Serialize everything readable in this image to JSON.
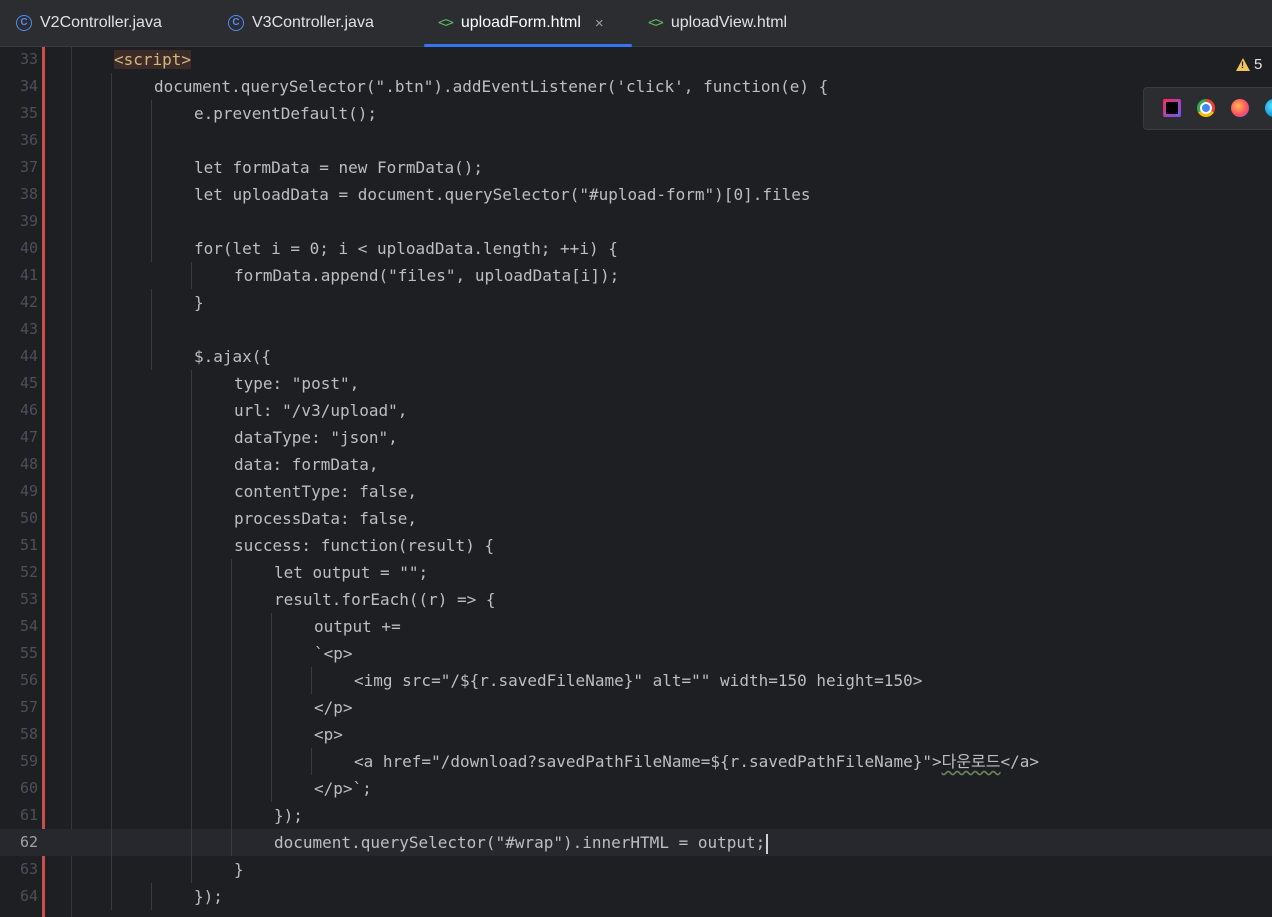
{
  "tabs": [
    {
      "label": "V2Controller.java",
      "icon": "class-icon",
      "active": false
    },
    {
      "label": "V3Controller.java",
      "icon": "class-icon",
      "active": false
    },
    {
      "label": "uploadForm.html",
      "icon": "html-icon",
      "active": true
    },
    {
      "label": "uploadView.html",
      "icon": "html-icon",
      "active": false
    }
  ],
  "tab_close_glyph": "×",
  "inspections": {
    "warning_count": "5"
  },
  "browser_icons": [
    "intellij-icon",
    "chrome-icon",
    "firefox-icon",
    "edge-icon"
  ],
  "editor": {
    "current_line": 62,
    "lines": [
      {
        "n": "33",
        "text": "<script>"
      },
      {
        "n": "34",
        "text": "document.querySelector(\".btn\").addEventListener('click', function(e) {"
      },
      {
        "n": "35",
        "text": "e.preventDefault();"
      },
      {
        "n": "36",
        "text": ""
      },
      {
        "n": "37",
        "text": "let formData = new FormData();"
      },
      {
        "n": "38",
        "text": "let uploadData = document.querySelector(\"#upload-form\")[0].files"
      },
      {
        "n": "39",
        "text": ""
      },
      {
        "n": "40",
        "text": "for(let i = 0; i < uploadData.length; ++i) {"
      },
      {
        "n": "41",
        "text": "formData.append(\"files\", uploadData[i]);"
      },
      {
        "n": "42",
        "text": "}"
      },
      {
        "n": "43",
        "text": ""
      },
      {
        "n": "44",
        "text": "$.ajax({"
      },
      {
        "n": "45",
        "text": "type: \"post\","
      },
      {
        "n": "46",
        "text": "url: \"/v3/upload\","
      },
      {
        "n": "47",
        "text": "dataType: \"json\","
      },
      {
        "n": "48",
        "text": "data: formData,"
      },
      {
        "n": "49",
        "text": "contentType: false,"
      },
      {
        "n": "50",
        "text": "processData: false,"
      },
      {
        "n": "51",
        "text": "success: function(result) {"
      },
      {
        "n": "52",
        "text": "let output = \"\";"
      },
      {
        "n": "53",
        "text": "result.forEach((r) => {"
      },
      {
        "n": "54",
        "text": "output +="
      },
      {
        "n": "55",
        "text": "`<p>"
      },
      {
        "n": "56",
        "text": "<img src=\"/${r.savedFileName}\" alt=\"\" width=150 height=150>"
      },
      {
        "n": "57",
        "text": "</p>"
      },
      {
        "n": "58",
        "text": "<p>"
      },
      {
        "n": "59",
        "text": "<a href=\"/download?savedPathFileName=${r.savedPathFileName}\">다운로드</a>"
      },
      {
        "n": "60",
        "text": "</p>`;"
      },
      {
        "n": "61",
        "text": "});"
      },
      {
        "n": "62",
        "text": "document.querySelector(\"#wrap\").innerHTML = output;"
      },
      {
        "n": "63",
        "text": "}"
      },
      {
        "n": "64",
        "text": "});"
      }
    ]
  }
}
